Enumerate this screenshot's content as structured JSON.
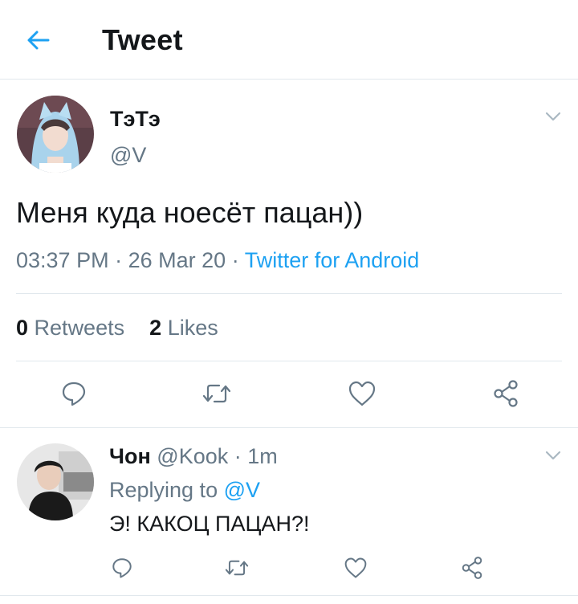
{
  "header": {
    "title": "Tweet",
    "back_icon": "arrow-left-icon"
  },
  "tweet": {
    "display_name": "ТэТэ",
    "handle": "@V",
    "text": "Меня куда ноесёт пацан))",
    "time": "03:37 PM",
    "date": "26 Mar 20",
    "separator": "·",
    "source": "Twitter for Android",
    "retweets_count": "0",
    "retweets_label": "Retweets",
    "likes_count": "2",
    "likes_label": "Likes"
  },
  "reply": {
    "display_name": "Чон",
    "handle": "@Kook",
    "separator": "·",
    "age": "1m",
    "replying_prefix": "Replying to",
    "replying_to": "@V",
    "text": "Э! КАКОЦ ПАЦАН?!"
  },
  "actions": [
    "reply-icon",
    "retweet-icon",
    "like-icon",
    "share-icon"
  ],
  "colors": {
    "accent": "#1da1f2",
    "muted": "#657786",
    "border": "#e1e8ed",
    "text": "#14171a"
  }
}
